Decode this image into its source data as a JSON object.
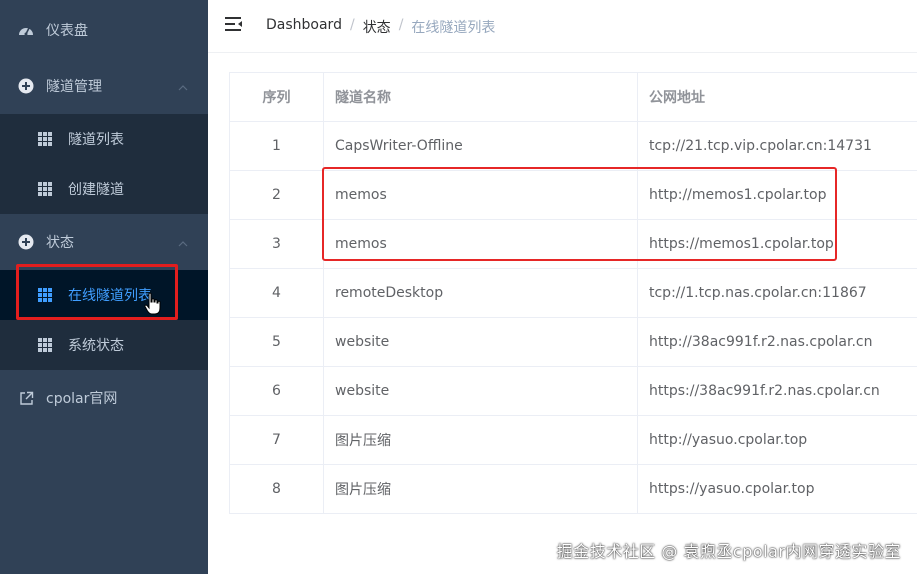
{
  "sidebar": {
    "dashboard_label": "仪表盘",
    "tunnel_mgmt_label": "隧道管理",
    "tunnel_list_label": "隧道列表",
    "create_tunnel_label": "创建隧道",
    "status_label": "状态",
    "online_tunnels_label": "在线隧道列表",
    "system_status_label": "系统状态",
    "cpolar_site_label": "cpolar官网"
  },
  "breadcrumb": {
    "home": "Dashboard",
    "sep": "/",
    "level1": "状态",
    "current": "在线隧道列表"
  },
  "table": {
    "headers": [
      "序列",
      "隧道名称",
      "公网地址"
    ],
    "rows": [
      {
        "idx": "1",
        "name": "CapsWriter-Offline",
        "url": "tcp://21.tcp.vip.cpolar.cn:14731"
      },
      {
        "idx": "2",
        "name": "memos",
        "url": "http://memos1.cpolar.top"
      },
      {
        "idx": "3",
        "name": "memos",
        "url": "https://memos1.cpolar.top"
      },
      {
        "idx": "4",
        "name": "remoteDesktop",
        "url": "tcp://1.tcp.nas.cpolar.cn:11867"
      },
      {
        "idx": "5",
        "name": "website",
        "url": "http://38ac991f.r2.nas.cpolar.cn"
      },
      {
        "idx": "6",
        "name": "website",
        "url": "https://38ac991f.r2.nas.cpolar.cn"
      },
      {
        "idx": "7",
        "name": "图片压缩",
        "url": "http://yasuo.cpolar.top"
      },
      {
        "idx": "8",
        "name": "图片压缩",
        "url": "https://yasuo.cpolar.top"
      }
    ]
  },
  "watermark": "掘金技术社区 @ 袁煦丞cpolar内网穿透实验室",
  "colors": {
    "sidebar_bg": "#304156",
    "submenu_bg": "#1f2d3d",
    "active_bg": "#001528",
    "active_text": "#409eff",
    "highlight_red": "#e21e1e"
  }
}
